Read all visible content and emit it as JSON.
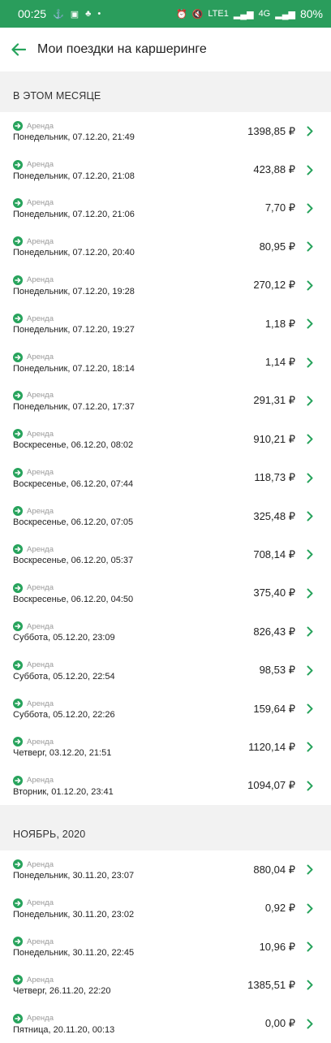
{
  "status_bar": {
    "time": "00:25",
    "battery": "80%",
    "network": "LTE1",
    "network_gen": "4G"
  },
  "app_bar": {
    "title": "Мои поездки на каршеринге"
  },
  "sections": [
    {
      "title": "В ЭТОМ МЕСЯЦЕ",
      "items": [
        {
          "type": "Аренда",
          "date": "Понедельник, 07.12.20, 21:49",
          "amount": "1398,85 ₽"
        },
        {
          "type": "Аренда",
          "date": "Понедельник, 07.12.20, 21:08",
          "amount": "423,88 ₽"
        },
        {
          "type": "Аренда",
          "date": "Понедельник, 07.12.20, 21:06",
          "amount": "7,70 ₽"
        },
        {
          "type": "Аренда",
          "date": "Понедельник, 07.12.20, 20:40",
          "amount": "80,95 ₽"
        },
        {
          "type": "Аренда",
          "date": "Понедельник, 07.12.20, 19:28",
          "amount": "270,12 ₽"
        },
        {
          "type": "Аренда",
          "date": "Понедельник, 07.12.20, 19:27",
          "amount": "1,18 ₽"
        },
        {
          "type": "Аренда",
          "date": "Понедельник, 07.12.20, 18:14",
          "amount": "1,14 ₽"
        },
        {
          "type": "Аренда",
          "date": "Понедельник, 07.12.20, 17:37",
          "amount": "291,31 ₽"
        },
        {
          "type": "Аренда",
          "date": "Воскресенье, 06.12.20, 08:02",
          "amount": "910,21 ₽"
        },
        {
          "type": "Аренда",
          "date": "Воскресенье, 06.12.20, 07:44",
          "amount": "118,73 ₽"
        },
        {
          "type": "Аренда",
          "date": "Воскресенье, 06.12.20, 07:05",
          "amount": "325,48 ₽"
        },
        {
          "type": "Аренда",
          "date": "Воскресенье, 06.12.20, 05:37",
          "amount": "708,14 ₽"
        },
        {
          "type": "Аренда",
          "date": "Воскресенье, 06.12.20, 04:50",
          "amount": "375,40 ₽"
        },
        {
          "type": "Аренда",
          "date": "Суббота, 05.12.20, 23:09",
          "amount": "826,43 ₽"
        },
        {
          "type": "Аренда",
          "date": "Суббота, 05.12.20, 22:54",
          "amount": "98,53 ₽"
        },
        {
          "type": "Аренда",
          "date": "Суббота, 05.12.20, 22:26",
          "amount": "159,64 ₽"
        },
        {
          "type": "Аренда",
          "date": "Четверг, 03.12.20, 21:51",
          "amount": "1120,14 ₽"
        },
        {
          "type": "Аренда",
          "date": "Вторник, 01.12.20, 23:41",
          "amount": "1094,07 ₽"
        }
      ]
    },
    {
      "title": "НОЯБРЬ, 2020",
      "items": [
        {
          "type": "Аренда",
          "date": "Понедельник, 30.11.20, 23:07",
          "amount": "880,04 ₽"
        },
        {
          "type": "Аренда",
          "date": "Понедельник, 30.11.20, 23:02",
          "amount": "0,92 ₽"
        },
        {
          "type": "Аренда",
          "date": "Понедельник, 30.11.20, 22:45",
          "amount": "10,96 ₽"
        },
        {
          "type": "Аренда",
          "date": "Четверг, 26.11.20, 22:20",
          "amount": "1385,51 ₽"
        },
        {
          "type": "Аренда",
          "date": "Пятница, 20.11.20, 00:13",
          "amount": "0,00 ₽"
        }
      ]
    }
  ],
  "colors": {
    "accent": "#27a35c",
    "status_bar": "#2a9d5c",
    "section_bg": "#f2f2f2"
  },
  "icons": {
    "back": "arrow-left-icon",
    "row_type": "arrow-right-circle-icon",
    "row_action": "chevron-right-icon"
  }
}
